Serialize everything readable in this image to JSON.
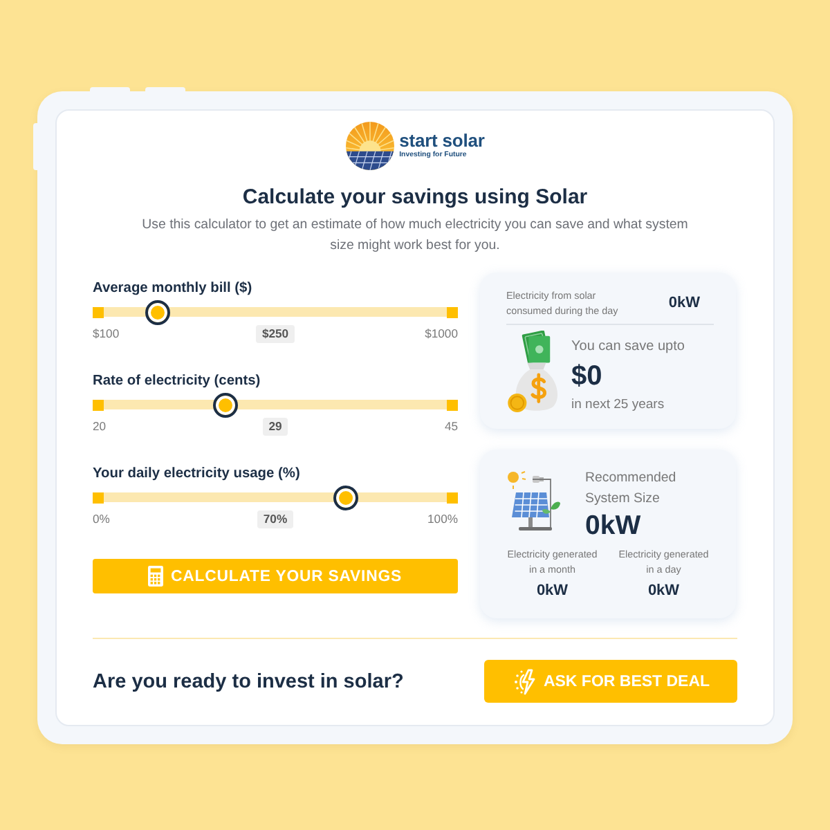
{
  "logo": {
    "name": "start solar",
    "tagline": "Investing for Future"
  },
  "title": "Calculate your savings using Solar",
  "description": "Use this calculator to get an estimate of how much electricity you can save and what system size might work best for you.",
  "sliders": [
    {
      "label": "Average monthly bill ($)",
      "min": "$100",
      "value": "$250",
      "max": "$1000",
      "level": 0.167
    },
    {
      "label": "Rate of electricity (cents)",
      "min": "20",
      "value": "29",
      "max": "45",
      "level": 0.36
    },
    {
      "label": "Your daily electricity usage (%)",
      "min": "0%",
      "value": "70%",
      "max": "100%",
      "level": 0.7
    }
  ],
  "calculate_button": "CALCULATE YOUR SAVINGS",
  "savings_card": {
    "consumed_label": "Electricity from solar consumed during the day",
    "consumed_value": "0kW",
    "save_label": "You can save upto",
    "amount": "$0",
    "period": "in next 25 years"
  },
  "system_card": {
    "label": "Recommended System Size",
    "size": "0kW",
    "stats": [
      {
        "label": "Electricity generated in a month",
        "value": "0kW"
      },
      {
        "label": "Electricity generated in a day",
        "value": "0kW"
      }
    ]
  },
  "cta": {
    "question": "Are you ready to invest in solar?",
    "button": "ASK FOR BEST DEAL"
  }
}
